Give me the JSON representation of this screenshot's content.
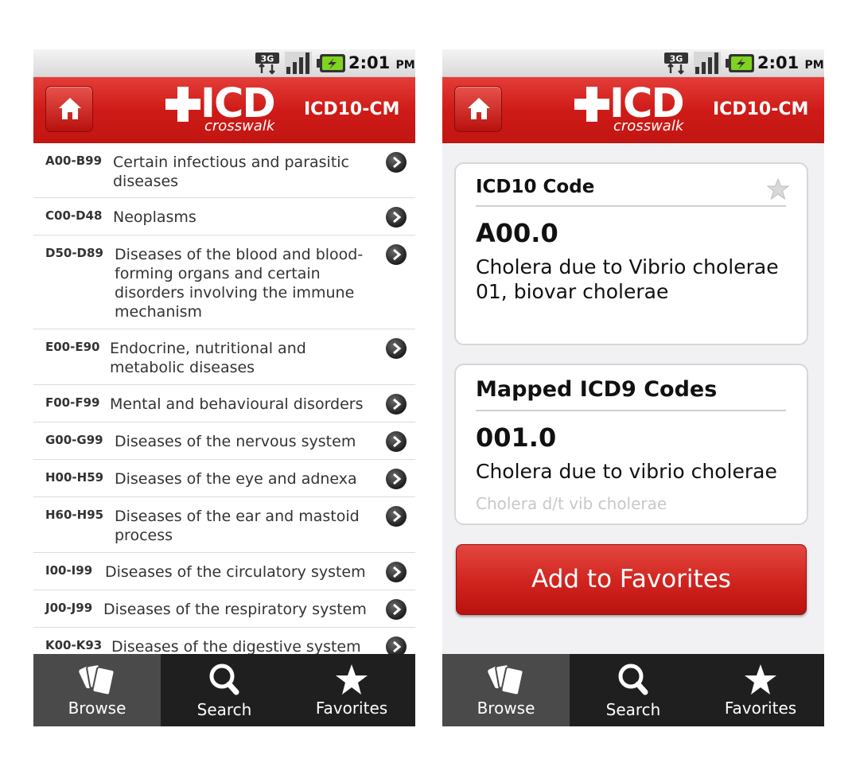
{
  "status_bar": {
    "network_icon": "3g-icon",
    "signal_icon": "signal-bars-icon",
    "battery_icon": "battery-charging-icon",
    "time": "2:01",
    "ampm": "PM"
  },
  "header": {
    "logo_plus_icon": "plus-icon",
    "logo_text": "ICD",
    "logo_subtext": "crosswalk",
    "title": "ICD10-CM",
    "home_icon": "home-icon"
  },
  "browse_list": [
    {
      "code": "A00-B99",
      "title": "Certain infectious and parasitic diseases"
    },
    {
      "code": "C00-D48",
      "title": "Neoplasms"
    },
    {
      "code": "D50-D89",
      "title": "Diseases of the blood and blood-forming organs and certain disorders involving the immune mechanism"
    },
    {
      "code": "E00-E90",
      "title": "Endocrine, nutritional and metabolic diseases"
    },
    {
      "code": "F00-F99",
      "title": "Mental and behavioural disorders"
    },
    {
      "code": "G00-G99",
      "title": "Diseases of the nervous system"
    },
    {
      "code": "H00-H59",
      "title": "Diseases of the eye and adnexa"
    },
    {
      "code": "H60-H95",
      "title": "Diseases of the ear and mastoid process"
    },
    {
      "code": "I00-I99",
      "title": "Diseases of the circulatory system"
    },
    {
      "code": "J00-J99",
      "title": "Diseases of the respiratory system"
    },
    {
      "code": "K00-K93",
      "title": "Diseases of the digestive system"
    }
  ],
  "detail": {
    "icd10_heading": "ICD10 Code",
    "icd10_code": "A00.0",
    "icd10_description": "Cholera due to Vibrio cholerae 01, biovar cholerae",
    "favorite_star_icon": "star-outline-icon",
    "icd9_heading": "Mapped ICD9 Codes",
    "icd9_code": "001.0",
    "icd9_description": "Cholera due to vibrio cholerae",
    "icd9_short": "Cholera d/t vib cholerae",
    "add_button": "Add to Favorites"
  },
  "tabs": [
    {
      "label": "Browse",
      "icon": "cards-icon"
    },
    {
      "label": "Search",
      "icon": "magnifier-icon"
    },
    {
      "label": "Favorites",
      "icon": "star-icon"
    }
  ],
  "colors": {
    "brand_red": "#cf1b17",
    "tab_bar": "#1f1f1f",
    "tab_active": "#4a4a4a",
    "secondary_text": "#c8c8c8"
  }
}
